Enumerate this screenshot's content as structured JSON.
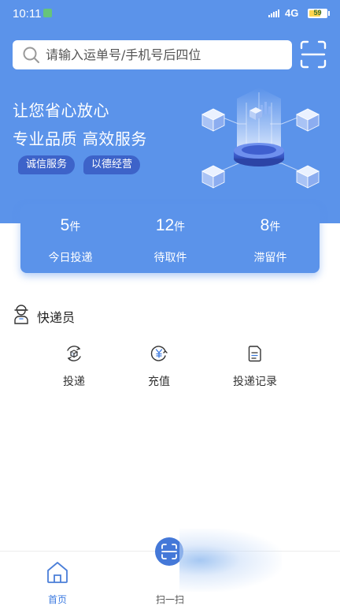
{
  "status_bar": {
    "time": "10:11",
    "network": "4G",
    "battery_level": "59",
    "battery_fraction": 0.59
  },
  "search": {
    "placeholder": "请输入运单号/手机号后四位"
  },
  "hero": {
    "line1": "让您省心放心",
    "line2": "专业品质 高效服务",
    "tags": [
      "诚信服务",
      "以德经营"
    ]
  },
  "stats": [
    {
      "value": "5",
      "unit": "件",
      "label": "今日投递"
    },
    {
      "value": "12",
      "unit": "件",
      "label": "待取件"
    },
    {
      "value": "8",
      "unit": "件",
      "label": "滞留件"
    }
  ],
  "courier_section": {
    "title": "快递员",
    "actions": [
      {
        "label": "投递",
        "icon": "parcel-cycle-icon"
      },
      {
        "label": "充值",
        "icon": "yen-coin-icon"
      },
      {
        "label": "投递记录",
        "icon": "document-icon"
      }
    ]
  },
  "tabbar": {
    "items": [
      {
        "label": "首页",
        "icon": "home-icon",
        "active": true
      },
      {
        "label": "扫一扫",
        "icon": "scan-icon",
        "active": false
      }
    ]
  },
  "colors": {
    "primary": "#5b93ea",
    "tag_bg": "#3d63c9",
    "active_tab": "#3d7be0"
  }
}
